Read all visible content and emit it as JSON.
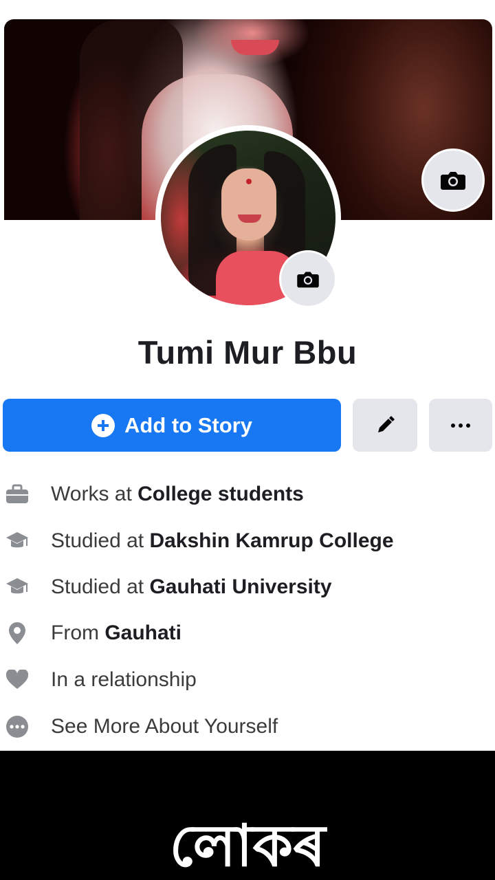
{
  "profile": {
    "name": "Tumi Mur Bbu"
  },
  "actions": {
    "add_story_label": "Add to Story",
    "edit_icon": "pencil-icon",
    "more_icon": "ellipsis-icon"
  },
  "info": [
    {
      "icon": "briefcase-icon",
      "prefix": "Works at ",
      "value": "College students"
    },
    {
      "icon": "graduation-cap-icon",
      "prefix": "Studied at ",
      "value": "Dakshin Kamrup College"
    },
    {
      "icon": "graduation-cap-icon",
      "prefix": "Studied at ",
      "value": "Gauhati University"
    },
    {
      "icon": "location-pin-icon",
      "prefix": "From ",
      "value": "Gauhati"
    },
    {
      "icon": "heart-icon",
      "prefix": "In a relationship",
      "value": ""
    },
    {
      "icon": "ellipsis-circle-icon",
      "prefix": "See More About Yourself",
      "value": ""
    }
  ],
  "caption": "লোকৰ",
  "colors": {
    "primary_button": "#1877f2",
    "secondary_button": "#e4e6eb",
    "footer_background": "#000000"
  }
}
